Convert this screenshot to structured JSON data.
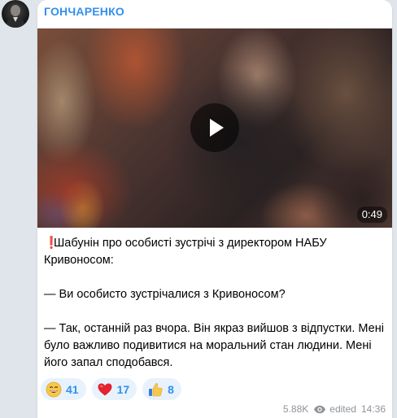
{
  "channel": {
    "name": "ГОНЧАРЕНКО",
    "avatar_icon": "channel-avatar-icon"
  },
  "video": {
    "duration": "0:49",
    "play_icon": "play-icon"
  },
  "message": {
    "paragraphs": [
      {
        "prefix": "❗",
        "text": "Шабунін про особисті зустрічі з директором НАБУ Кривоносом:"
      },
      {
        "prefix": "",
        "text": "— Ви особисто зустрічалися з Кривоносом?"
      },
      {
        "prefix": "",
        "text": "— Так, останній раз вчора. Він якраз вийшов з відпустки. Мені було важливо подивитися на моральний стан людини. Мені його запал сподобався."
      }
    ]
  },
  "reactions": [
    {
      "icon": "grinning-face-icon",
      "count": "41"
    },
    {
      "icon": "red-heart-icon",
      "count": "17"
    },
    {
      "icon": "thumbs-up-icon",
      "count": "8"
    }
  ],
  "meta": {
    "views": "5.88K",
    "views_icon": "eye-icon",
    "edited": "edited",
    "time": "14:36"
  },
  "colors": {
    "accent": "#3390ec",
    "background": "#dfe5ea",
    "bubble": "#ffffff",
    "reaction_bg": "#e8f2fd",
    "meta_text": "#8e9399",
    "alert": "#e0202a"
  }
}
